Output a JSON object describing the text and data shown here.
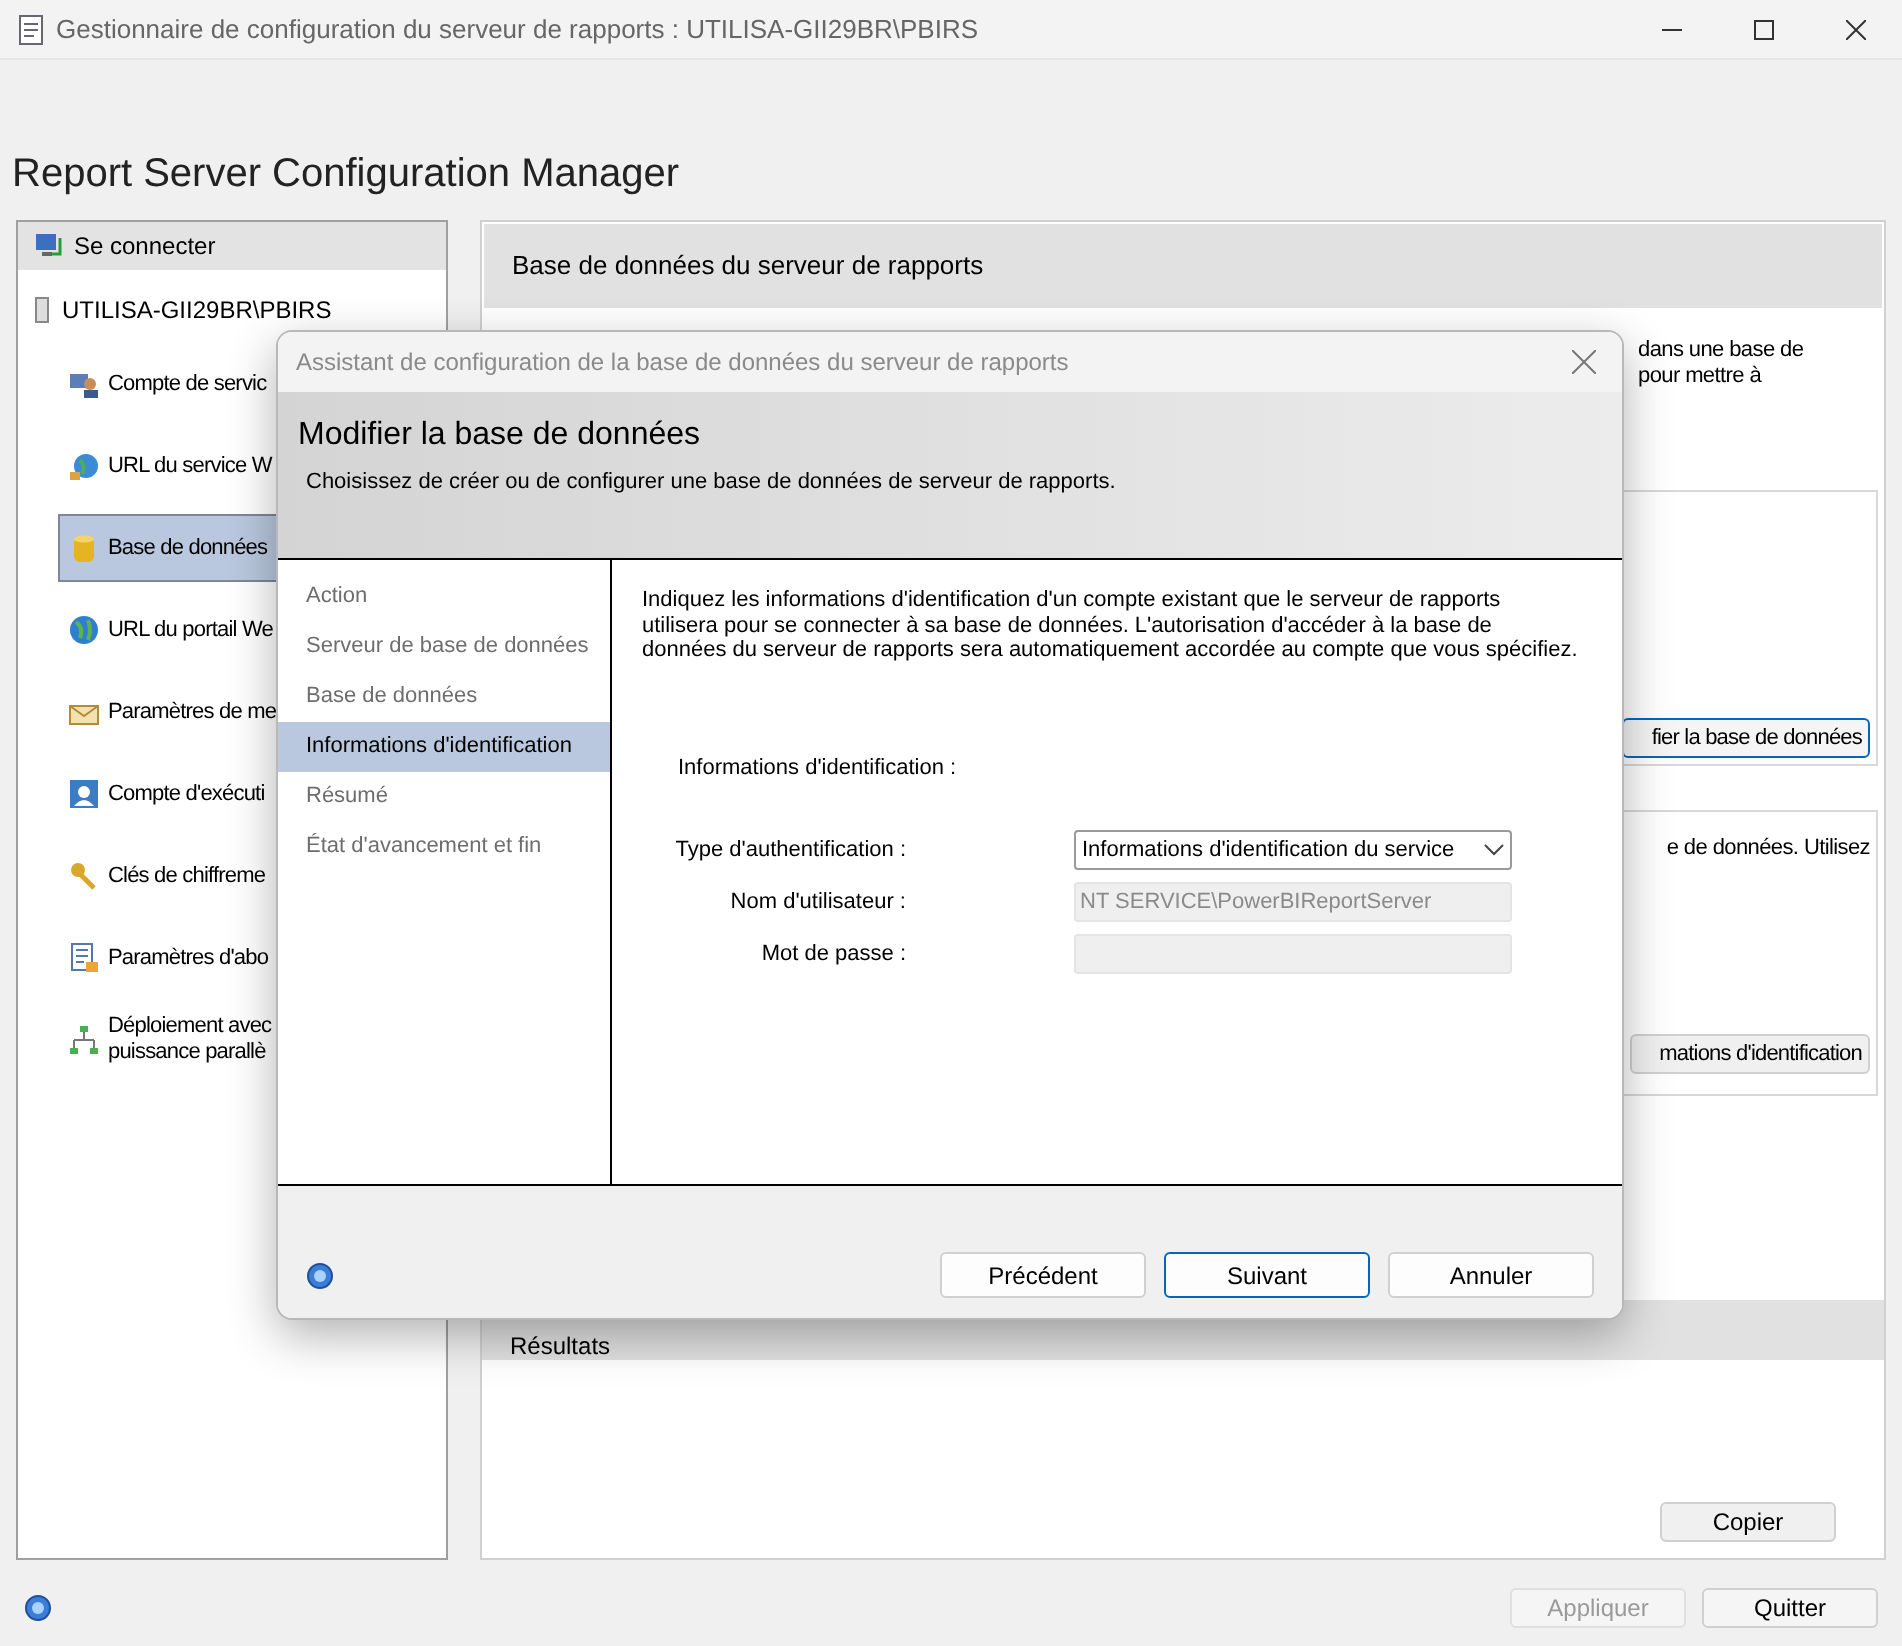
{
  "window": {
    "title": "Gestionnaire de configuration du serveur de rapports : UTILISA-GII29BR\\PBIRS"
  },
  "app_title": "Report Server Configuration Manager",
  "sidebar": {
    "connect_label": "Se connecter",
    "server": "UTILISA-GII29BR\\PBIRS",
    "items": [
      {
        "label": "Compte de servic",
        "selected": false
      },
      {
        "label": "URL du service W",
        "selected": false
      },
      {
        "label": "Base de données",
        "selected": true
      },
      {
        "label": "URL du portail We",
        "selected": false
      },
      {
        "label": "Paramètres de me",
        "selected": false
      },
      {
        "label": "Compte d'exécuti",
        "selected": false
      },
      {
        "label": "Clés de chiffreme",
        "selected": false
      },
      {
        "label": "Paramètres d'abo",
        "selected": false
      },
      {
        "label": "Déploiement avec\npuissance parallè",
        "selected": false
      }
    ]
  },
  "main": {
    "header": "Base de données du serveur de rapports",
    "intro_lines": [
      "dans une base de",
      "pour mettre à"
    ],
    "change_db_button": "fier la base de données",
    "credentials_text": "e de données. Utilisez",
    "credentials_button": "mations d'identification",
    "results_header": "Résultats",
    "copy_button": "Copier"
  },
  "footer": {
    "buttons": [
      {
        "label": "Appliquer",
        "disabled": true
      },
      {
        "label": "Quitter",
        "disabled": false
      }
    ]
  },
  "dialog": {
    "title": "Assistant de configuration de la base de données du serveur de rapports",
    "heading": "Modifier la base de données",
    "subheading": "Choisissez de créer ou de configurer une base de données de serveur de rapports.",
    "steps": [
      {
        "label": "Action",
        "selected": false
      },
      {
        "label": "Serveur de base de données",
        "selected": false
      },
      {
        "label": "Base de données",
        "selected": false
      },
      {
        "label": "Informations d'identification",
        "selected": true
      },
      {
        "label": "Résumé",
        "selected": false
      },
      {
        "label": "État d'avancement et fin",
        "selected": false
      }
    ],
    "description": "Indiquez les informations d'identification d'un compte existant que le serveur de rapports utilisera pour se connecter à sa base de données.  L'autorisation d'accéder à la base de données du serveur de rapports sera automatiquement accordée au compte que vous spécifiez.",
    "section_label": "Informations d'identification :",
    "fields": [
      {
        "kind": "select",
        "label": "Type d'authentification :",
        "value": "Informations d'identification du service",
        "disabled": false
      },
      {
        "kind": "text",
        "label": "Nom d'utilisateur :",
        "value": "NT SERVICE\\PowerBIReportServer",
        "disabled": true
      },
      {
        "kind": "password",
        "label": "Mot de passe :",
        "disabled": true
      }
    ],
    "buttons": [
      {
        "label": "Précédent",
        "default": false
      },
      {
        "label": "Suivant",
        "default": true
      },
      {
        "label": "Annuler",
        "default": false
      }
    ]
  }
}
